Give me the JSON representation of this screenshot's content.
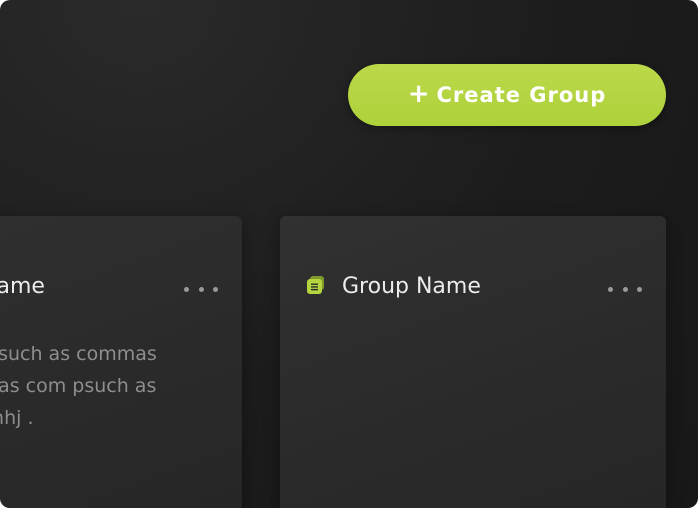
{
  "toolbar": {
    "create_group_plus": "+",
    "create_group_label": "Create Group"
  },
  "cards": [
    {
      "title": "Name",
      "more_icon": "ellipsis-horizontal-icon",
      "description_lines": [
        "n such as commas",
        "n as com psuch as",
        "dhhj ."
      ]
    },
    {
      "title": "Group Name",
      "icon": "group-stack-icon",
      "more_icon": "ellipsis-horizontal-icon"
    }
  ],
  "colors": {
    "accent": "#b5d53e",
    "background": "#1c1c1c",
    "card": "#2d2d2d",
    "title_text": "#ececec",
    "muted_text": "#8e8e8e"
  }
}
